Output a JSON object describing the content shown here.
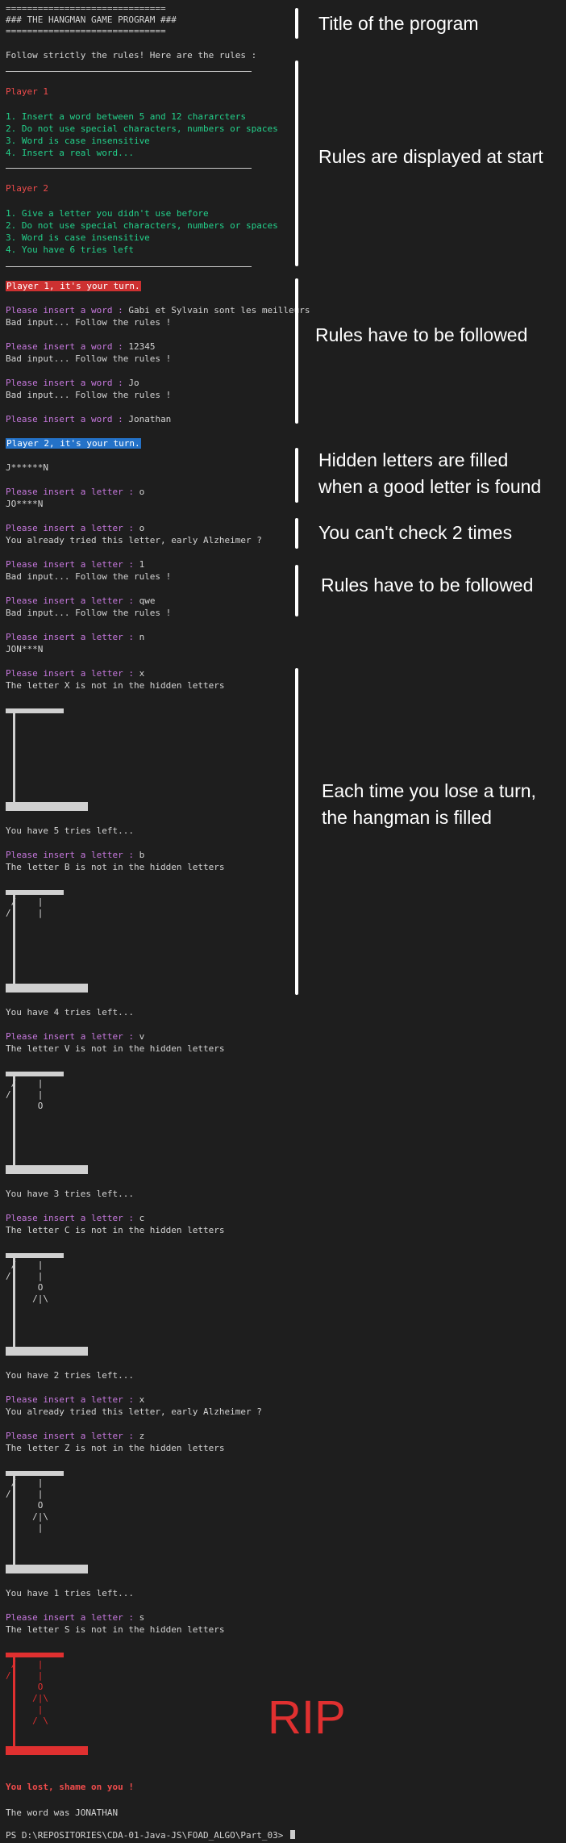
{
  "header": {
    "eq_line": "==============================",
    "title": "### THE HANGMAN GAME PROGRAM ###"
  },
  "rules": {
    "intro": "Follow strictly the rules! Here are the rules :",
    "p1_title": "Player 1",
    "p1_rules": [
      "1. Insert a word between 5 and 12 chararcters",
      "2. Do not use special characters, numbers or spaces",
      "3. Word is case insensitive",
      "4. Insert a real word..."
    ],
    "p2_title": "Player 2",
    "p2_rules": [
      "1. Give a letter you didn't use before",
      "2. Do not use special characters, numbers or spaces",
      "3. Word is case insensitive",
      "4. You have 6 tries left"
    ]
  },
  "turn1": {
    "banner": "Player 1, it's your turn.",
    "prompt": "Please insert a word : ",
    "bad": "Bad input... Follow the rules !",
    "inputs": [
      "Gabi et Sylvain sont les meilleurs",
      "12345",
      "Jo",
      "Jonathan"
    ]
  },
  "turn2": {
    "banner": "Player 2, it's your turn.",
    "prompt": "Please insert a letter : ",
    "masks": [
      "J******N",
      "JO****N",
      "JON***N"
    ],
    "already": "You already tried this letter, early Alzheimer ?",
    "bad": "Bad input... Follow the rules !",
    "inputs": [
      "o",
      "o",
      "1",
      "qwe",
      "n",
      "x",
      "b",
      "v",
      "c",
      "x",
      "z",
      "s"
    ],
    "not_in": [
      "The letter X is not in the hidden letters",
      "The letter B is not in the hidden letters",
      "The letter V is not in the hidden letters",
      "The letter C is not in the hidden letters",
      "The letter Z is not in the hidden letters",
      "The letter S is not in the hidden letters"
    ],
    "tries": [
      "You have 5 tries left...",
      "You have 4 tries left...",
      "You have 3 tries left...",
      "You have 2 tries left...",
      "You have 1 tries left..."
    ]
  },
  "hangman_figures": [
    "",
    " /    |\n/     |",
    " /    |\n/     |\n      O",
    " /    |\n/     |\n      O\n     /|\\",
    " /    |\n/     |\n      O\n     /|\\\n      |",
    " /    |\n/     |\n      O\n     /|\\\n      |\n     / \\"
  ],
  "ending": {
    "lost": "You lost, shame on you !",
    "word": "The word was JONATHAN",
    "prompt": "PS D:\\REPOSITORIES\\CDA-01-Java-JS\\FOAD_ALGO\\Part_03> "
  },
  "annotations": {
    "title": "Title of the program",
    "rules_start": "Rules are displayed at start",
    "rules_followed_1": "Rules have to be followed",
    "hidden": "Hidden letters are filled\nwhen a good letter is found",
    "cant_check": "You can't check 2 times",
    "rules_followed_2": "Rules have to be followed",
    "hangman": "Each time you lose a turn,\nthe hangman is filled",
    "rip": "RIP"
  },
  "colors": {
    "background": "#1e1e1e",
    "text": "#d4d4d4",
    "prompt": "#c678dd",
    "rules_green": "#23d18b",
    "player_red": "#f14c4c",
    "banner_red": "#cd3131",
    "banner_blue": "#2472c8",
    "annotation": "#ffffff",
    "rip": "#e03030"
  }
}
